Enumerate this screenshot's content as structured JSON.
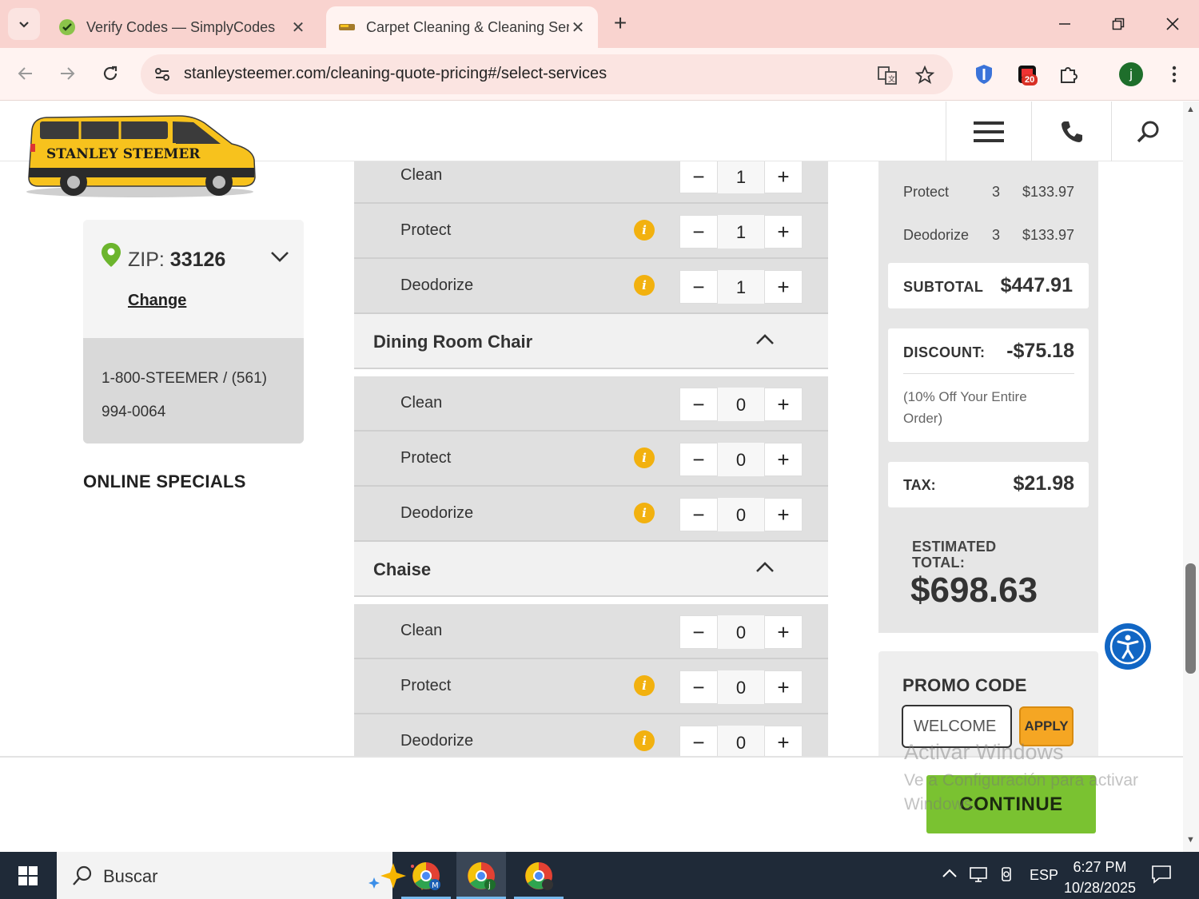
{
  "browser": {
    "tabs": [
      {
        "title": "Verify Codes — SimplyCodes",
        "active": false,
        "icon": "simplycodes-icon"
      },
      {
        "title": "Carpet Cleaning & Cleaning Ser",
        "active": true,
        "icon": "stanley-steemer-icon"
      }
    ],
    "url": "stanleysteemer.com/cleaning-quote-pricing#/select-services",
    "extension_badge": "20",
    "profile_initial": "j",
    "accent": "#f9d3cf"
  },
  "site": {
    "logo_text": "STANLEY STEEMER",
    "brand_color": "#f7c21d"
  },
  "location": {
    "zip_label": "ZIP:",
    "zip_value": "33126",
    "change_link": "Change",
    "phone_line1": "1-800-STEEMER / (561)",
    "phone_line2": "994-0064"
  },
  "online_specials": "ONLINE SPECIALS",
  "services": {
    "top_rows": [
      {
        "label": "Clean",
        "qty": "1",
        "info": false
      },
      {
        "label": "Protect",
        "qty": "1",
        "info": true
      },
      {
        "label": "Deodorize",
        "qty": "1",
        "info": true
      }
    ],
    "groups": [
      {
        "name": "Dining Room Chair",
        "rows": [
          {
            "label": "Clean",
            "qty": "0",
            "info": false
          },
          {
            "label": "Protect",
            "qty": "0",
            "info": true
          },
          {
            "label": "Deodorize",
            "qty": "0",
            "info": true
          }
        ]
      },
      {
        "name": "Chaise",
        "rows": [
          {
            "label": "Clean",
            "qty": "0",
            "info": false
          },
          {
            "label": "Protect",
            "qty": "0",
            "info": true
          },
          {
            "label": "Deodorize",
            "qty": "0",
            "info": true
          }
        ]
      }
    ],
    "minus": "−",
    "plus": "+",
    "info_glyph": "i"
  },
  "summary": {
    "lines": [
      {
        "label": "Protect",
        "qty": "3",
        "amount": "$133.97"
      },
      {
        "label": "Deodorize",
        "qty": "3",
        "amount": "$133.97"
      }
    ],
    "subtotal_label": "SUBTOTAL",
    "subtotal": "$447.91",
    "discount_label": "DISCOUNT:",
    "discount": "-$75.18",
    "discount_note": "(10% Off Your Entire Order)",
    "tax_label": "TAX:",
    "tax": "$21.98",
    "estimated_label": "ESTIMATED TOTAL:",
    "estimated_total": "$698.63"
  },
  "promo": {
    "title": "PROMO CODE",
    "value": "WELCOME",
    "apply": "APPLY"
  },
  "continue_label": "CONTINUE",
  "watermark": {
    "title": "Activar Windows",
    "subtitle": "Ve a Configuración para activar Windows."
  },
  "taskbar": {
    "search_placeholder": "Buscar",
    "language": "ESP",
    "time": "6:27 PM",
    "date": "10/28/2025"
  }
}
